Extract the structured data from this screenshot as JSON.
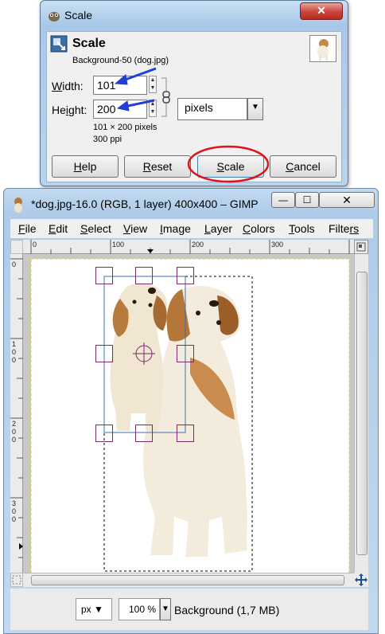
{
  "scale_dialog": {
    "window_title": "Scale",
    "header_title": "Scale",
    "header_subtitle": "Background-50 (dog.jpg)",
    "width_label_prefix": "W",
    "width_label_rest": "idth:",
    "width_value": "101",
    "height_label_prefix": "He",
    "height_label_mid": "i",
    "height_label_rest": "ght:",
    "height_value": "200",
    "size_info": "101 × 200 pixels",
    "resolution_info": "300 ppi",
    "unit_value": "pixels",
    "buttons": {
      "help": {
        "mn": "H",
        "rest": "elp"
      },
      "reset": {
        "mn": "R",
        "rest": "eset"
      },
      "scale": {
        "mn": "S",
        "rest": "cale"
      },
      "cancel": {
        "mn": "C",
        "rest": "ancel"
      }
    },
    "close_glyph": "✕"
  },
  "gimp_window": {
    "title": "*dog.jpg-16.0 (RGB, 1 layer) 400x400 – GIMP",
    "minimize_glyph": "—",
    "maximize_glyph": "☐",
    "close_glyph": "✕",
    "menu": [
      {
        "mn": "F",
        "rest": "ile"
      },
      {
        "mn": "E",
        "rest": "dit"
      },
      {
        "mn": "S",
        "rest": "elect"
      },
      {
        "mn": "V",
        "rest": "iew"
      },
      {
        "mn": "I",
        "rest": "mage"
      },
      {
        "mn": "L",
        "rest": "ayer"
      },
      {
        "mn": "C",
        "rest": "olors"
      },
      {
        "mn": "T",
        "rest": "ools"
      },
      {
        "mn": "Filte",
        "rest": "rs"
      }
    ],
    "ruler_h": [
      "0",
      "100",
      "200",
      "300"
    ],
    "ruler_v": [
      "0",
      "100",
      "200",
      "300"
    ],
    "status": {
      "unit": "px",
      "zoom": "100 %",
      "layer_info": "Background (1,7 MB)"
    }
  },
  "colors": {
    "annotation_arrow": "#1f3fd6",
    "annotation_circle": "#e0121d",
    "handle": "#7b2a6b",
    "canvas_border": "#e6d800"
  },
  "icons": [
    "gimp-app-icon",
    "scale-tool-icon",
    "chain-link-icon",
    "dog-thumbnail-icon",
    "navigate-icon",
    "quick-mask-icon",
    "zoom-toggle-icon"
  ]
}
